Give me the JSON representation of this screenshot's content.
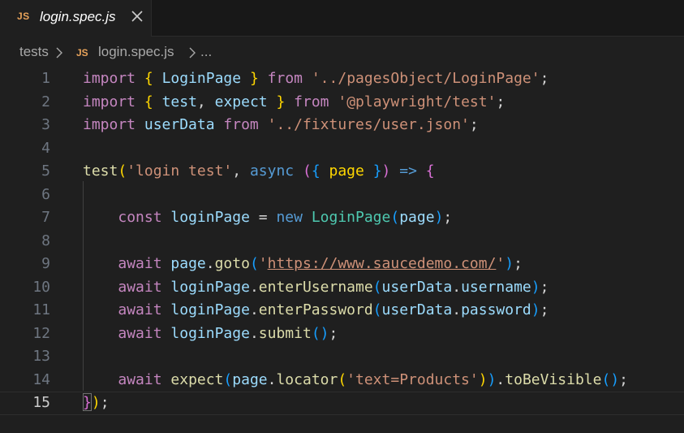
{
  "tab": {
    "icon": "JS",
    "title": "login.spec.js"
  },
  "breadcrumb": {
    "folder": "tests",
    "file_icon": "JS",
    "file": "login.spec.js",
    "more": "..."
  },
  "editor": {
    "current_line": "15",
    "lines": [
      {
        "num": "1",
        "tokens": [
          [
            "c-kw",
            "import"
          ],
          [
            "c-pl",
            " "
          ],
          [
            "c-p1",
            "{"
          ],
          [
            "c-pl",
            " "
          ],
          [
            "c-var",
            "LoginPage"
          ],
          [
            "c-pl",
            " "
          ],
          [
            "c-p1",
            "}"
          ],
          [
            "c-pl",
            " "
          ],
          [
            "c-kw",
            "from"
          ],
          [
            "c-pl",
            " "
          ],
          [
            "c-str",
            "'../pagesObject/LoginPage'"
          ],
          [
            "c-pl",
            ";"
          ]
        ]
      },
      {
        "num": "2",
        "tokens": [
          [
            "c-kw",
            "import"
          ],
          [
            "c-pl",
            " "
          ],
          [
            "c-p1",
            "{"
          ],
          [
            "c-pl",
            " "
          ],
          [
            "c-var",
            "test"
          ],
          [
            "c-pl",
            ", "
          ],
          [
            "c-var",
            "expect"
          ],
          [
            "c-pl",
            " "
          ],
          [
            "c-p1",
            "}"
          ],
          [
            "c-pl",
            " "
          ],
          [
            "c-kw",
            "from"
          ],
          [
            "c-pl",
            " "
          ],
          [
            "c-str",
            "'@playwright/test'"
          ],
          [
            "c-pl",
            ";"
          ]
        ]
      },
      {
        "num": "3",
        "tokens": [
          [
            "c-kw",
            "import"
          ],
          [
            "c-pl",
            " "
          ],
          [
            "c-var",
            "userData"
          ],
          [
            "c-pl",
            " "
          ],
          [
            "c-kw",
            "from"
          ],
          [
            "c-pl",
            " "
          ],
          [
            "c-str",
            "'../fixtures/user.json'"
          ],
          [
            "c-pl",
            ";"
          ]
        ]
      },
      {
        "num": "4",
        "tokens": []
      },
      {
        "num": "5",
        "tokens": [
          [
            "c-fn",
            "test"
          ],
          [
            "c-p1",
            "("
          ],
          [
            "c-str",
            "'login test'"
          ],
          [
            "c-pl",
            ", "
          ],
          [
            "c-decl",
            "async"
          ],
          [
            "c-pl",
            " "
          ],
          [
            "c-p2",
            "("
          ],
          [
            "c-p3",
            "{"
          ],
          [
            "c-pl",
            " "
          ],
          [
            "c-p1",
            "page"
          ],
          [
            "c-pl",
            " "
          ],
          [
            "c-p3",
            "}"
          ],
          [
            "c-p2",
            ")"
          ],
          [
            "c-pl",
            " "
          ],
          [
            "c-decl",
            "=>"
          ],
          [
            "c-pl",
            " "
          ],
          [
            "c-p2",
            "{"
          ]
        ]
      },
      {
        "num": "6",
        "tokens": []
      },
      {
        "num": "7",
        "tokens": [
          [
            "c-pl",
            "    "
          ],
          [
            "c-kw",
            "const"
          ],
          [
            "c-pl",
            " "
          ],
          [
            "c-var",
            "loginPage"
          ],
          [
            "c-pl",
            " = "
          ],
          [
            "c-decl",
            "new"
          ],
          [
            "c-pl",
            " "
          ],
          [
            "c-cls",
            "LoginPage"
          ],
          [
            "c-p3",
            "("
          ],
          [
            "c-prm",
            "page"
          ],
          [
            "c-p3",
            ")"
          ],
          [
            "c-pl",
            ";"
          ]
        ]
      },
      {
        "num": "8",
        "tokens": []
      },
      {
        "num": "9",
        "tokens": [
          [
            "c-pl",
            "    "
          ],
          [
            "c-kw",
            "await"
          ],
          [
            "c-pl",
            " "
          ],
          [
            "c-var",
            "page"
          ],
          [
            "c-pl",
            "."
          ],
          [
            "c-fn",
            "goto"
          ],
          [
            "c-p3",
            "("
          ],
          [
            "c-str",
            "'"
          ],
          [
            "c-url",
            "https://www.saucedemo.com/"
          ],
          [
            "c-str",
            "'"
          ],
          [
            "c-p3",
            ")"
          ],
          [
            "c-pl",
            ";"
          ]
        ]
      },
      {
        "num": "10",
        "tokens": [
          [
            "c-pl",
            "    "
          ],
          [
            "c-kw",
            "await"
          ],
          [
            "c-pl",
            " "
          ],
          [
            "c-var",
            "loginPage"
          ],
          [
            "c-pl",
            "."
          ],
          [
            "c-fn",
            "enterUsername"
          ],
          [
            "c-p3",
            "("
          ],
          [
            "c-var",
            "userData"
          ],
          [
            "c-pl",
            "."
          ],
          [
            "c-var",
            "username"
          ],
          [
            "c-p3",
            ")"
          ],
          [
            "c-pl",
            ";"
          ]
        ]
      },
      {
        "num": "11",
        "tokens": [
          [
            "c-pl",
            "    "
          ],
          [
            "c-kw",
            "await"
          ],
          [
            "c-pl",
            " "
          ],
          [
            "c-var",
            "loginPage"
          ],
          [
            "c-pl",
            "."
          ],
          [
            "c-fn",
            "enterPassword"
          ],
          [
            "c-p3",
            "("
          ],
          [
            "c-var",
            "userData"
          ],
          [
            "c-pl",
            "."
          ],
          [
            "c-var",
            "password"
          ],
          [
            "c-p3",
            ")"
          ],
          [
            "c-pl",
            ";"
          ]
        ]
      },
      {
        "num": "12",
        "tokens": [
          [
            "c-pl",
            "    "
          ],
          [
            "c-kw",
            "await"
          ],
          [
            "c-pl",
            " "
          ],
          [
            "c-var",
            "loginPage"
          ],
          [
            "c-pl",
            "."
          ],
          [
            "c-fn",
            "submit"
          ],
          [
            "c-p3",
            "()"
          ],
          [
            "c-pl",
            ";"
          ]
        ]
      },
      {
        "num": "13",
        "tokens": []
      },
      {
        "num": "14",
        "tokens": [
          [
            "c-pl",
            "    "
          ],
          [
            "c-kw",
            "await"
          ],
          [
            "c-pl",
            " "
          ],
          [
            "c-fn",
            "expect"
          ],
          [
            "c-p3",
            "("
          ],
          [
            "c-var",
            "page"
          ],
          [
            "c-pl",
            "."
          ],
          [
            "c-fn",
            "locator"
          ],
          [
            "c-p1",
            "("
          ],
          [
            "c-str",
            "'text=Products'"
          ],
          [
            "c-p1",
            ")"
          ],
          [
            "c-p3",
            ")"
          ],
          [
            "c-pl",
            "."
          ],
          [
            "c-fn",
            "toBeVisible"
          ],
          [
            "c-p3",
            "()"
          ],
          [
            "c-pl",
            ";"
          ]
        ]
      },
      {
        "num": "15",
        "tokens": [
          [
            "c-p2",
            "}"
          ],
          [
            "c-p1",
            ")"
          ],
          [
            "c-pl",
            ";"
          ]
        ]
      }
    ]
  },
  "colors": {
    "background": "#1f1f1f",
    "tabbar": "#181818",
    "js_icon": "#e8a35a",
    "keyword": "#c586c0",
    "string": "#ce9178",
    "function": "#dcdcaa",
    "variable": "#9cdcfe",
    "class": "#4ec9b0"
  }
}
